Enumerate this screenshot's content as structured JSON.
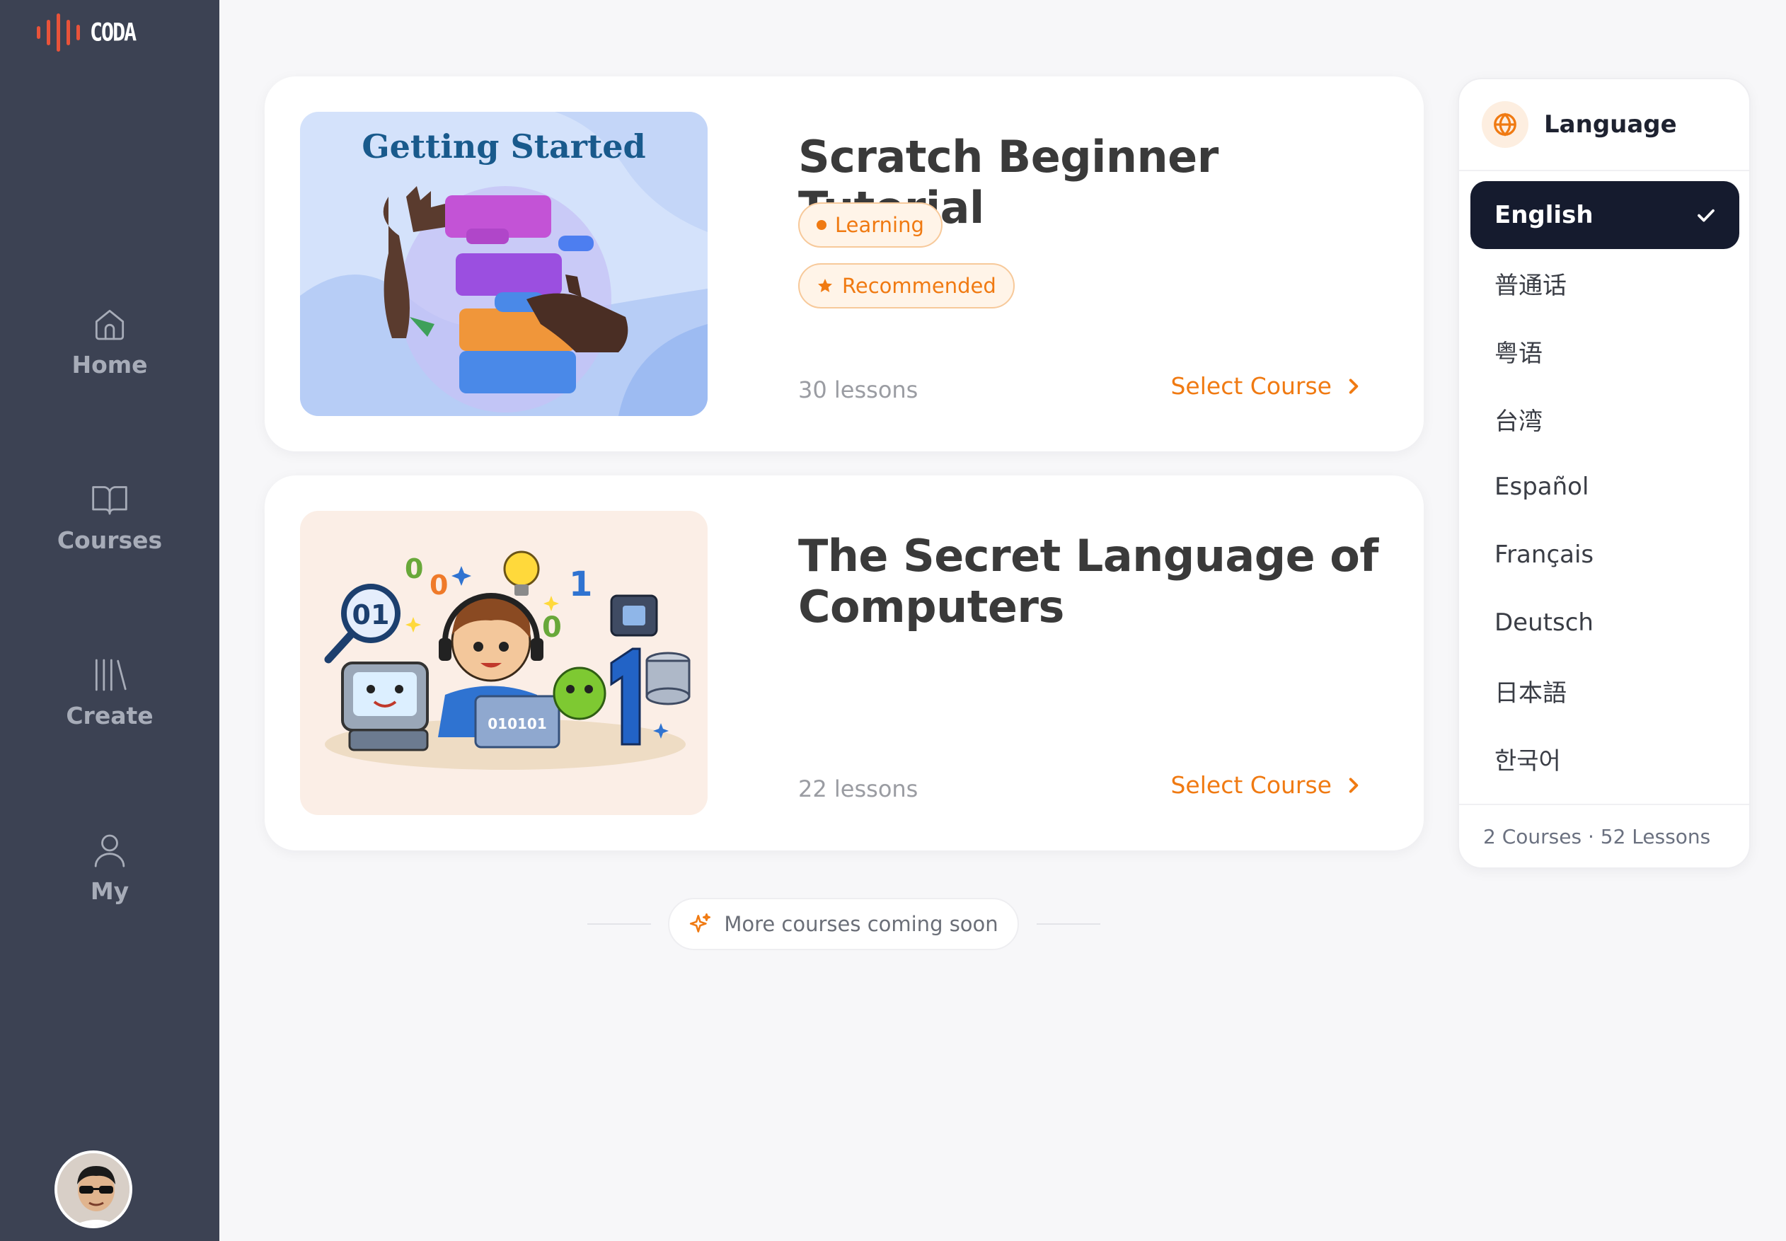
{
  "app": {
    "logo_text": "CODA",
    "accent_color": "#f07a12",
    "sidebar_color": "#3c4253"
  },
  "sidebar": {
    "items": [
      {
        "label": "Home",
        "icon": "home-icon"
      },
      {
        "label": "Courses",
        "icon": "book-icon"
      },
      {
        "label": "Create",
        "icon": "library-icon"
      },
      {
        "label": "My",
        "icon": "user-icon"
      }
    ],
    "avatar": "avatar"
  },
  "courses": [
    {
      "title": "Scratch Beginner Tutorial",
      "image_caption": "Getting Started",
      "badges": [
        "Learning",
        "Recommended"
      ],
      "lessons": "30 lessons",
      "action": "Select Course"
    },
    {
      "title": "The Secret Language of Computers",
      "image_caption": "",
      "badges": [],
      "lessons": "22 lessons",
      "action": "Select Course"
    }
  ],
  "coming_soon": {
    "label": "More courses coming soon",
    "icon": "sparkle-icon"
  },
  "language_panel": {
    "title": "Language",
    "icon": "globe-icon",
    "selected": "English",
    "options": [
      "English",
      "普通话",
      "粤语",
      "台湾",
      "Español",
      "Français",
      "Deutsch",
      "日本語",
      "한국어"
    ],
    "footer": "2 Courses · 52 Lessons"
  }
}
